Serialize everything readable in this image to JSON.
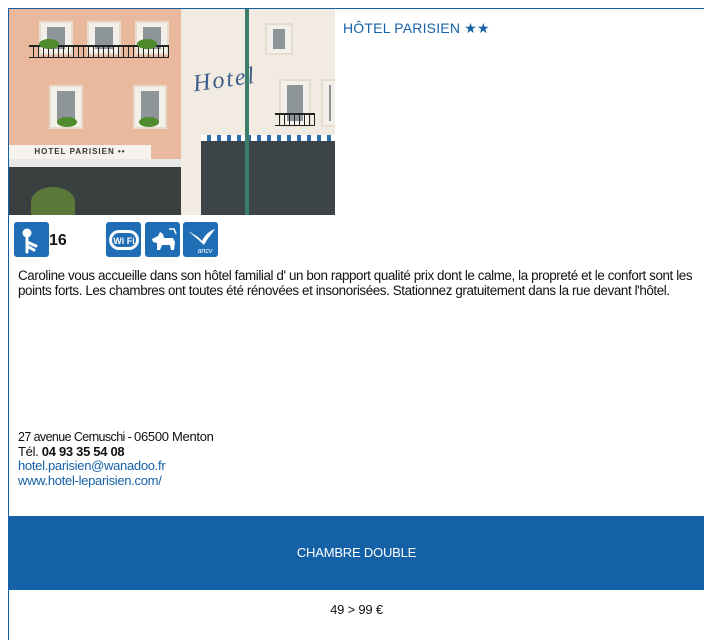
{
  "hotel": {
    "title": "HÔTEL PARISIEN ★★",
    "photo_sign": "HOTEL PARISIEN ••",
    "photo_facade_word": "Hotel",
    "rooms_count": "16",
    "amenities": [
      {
        "name": "wifi",
        "label": "Wi Fi"
      },
      {
        "name": "pets-allowed",
        "label": ""
      },
      {
        "name": "ancv",
        "label": "ancv"
      }
    ],
    "description": "Caroline vous accueille dans son hôtel familial d' un bon rapport qualité prix dont le calme, la propreté et le confort sont les points forts. Les chambres ont toutes été rénovées et insonorisées. Stationnez gratuitement dans la rue devant l'hôtel.",
    "address_street": "27 avenue Cernuschi - ",
    "address_city": "06500 Menton",
    "phone_prefix": "Tél. ",
    "phone": "04 93 35 54 08",
    "email": "hotel.parisien@wanadoo.fr",
    "website": "www.hotel-leparisien.com/"
  },
  "pricing": {
    "room_type": "CHAMBRE DOUBLE",
    "price_range": "49 > 99 €"
  },
  "colors": {
    "accent": "#1561a8",
    "icon_bg": "#1f6db5"
  }
}
